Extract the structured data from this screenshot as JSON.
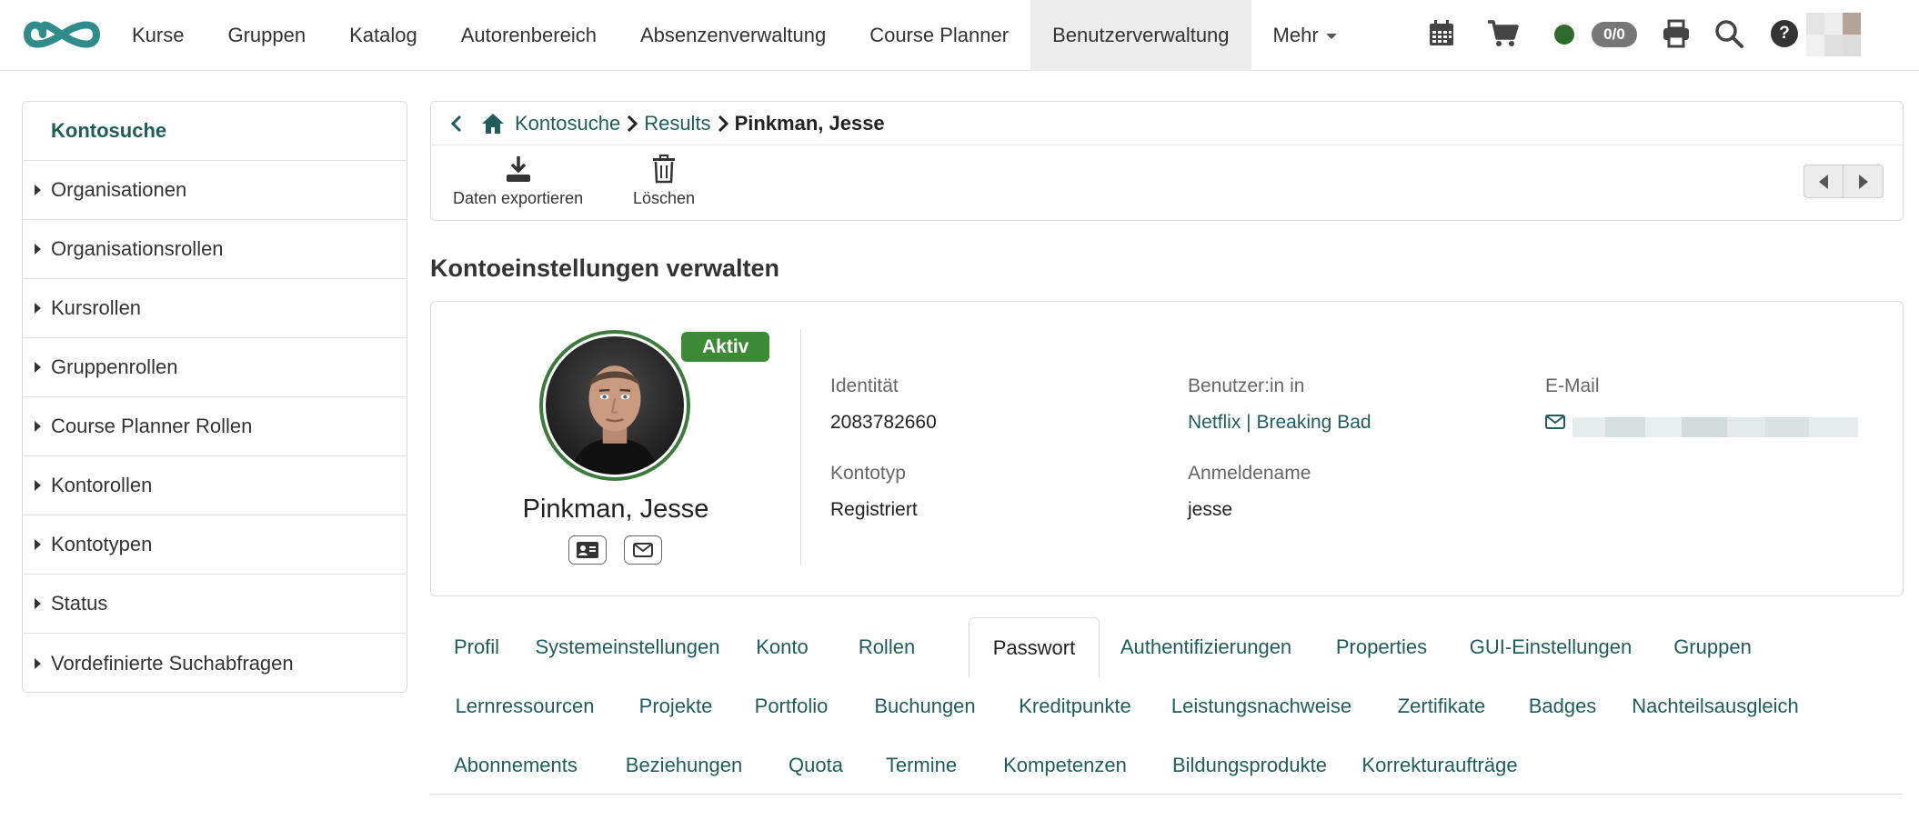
{
  "nav": {
    "items": [
      {
        "label": "Kurse"
      },
      {
        "label": "Gruppen"
      },
      {
        "label": "Katalog"
      },
      {
        "label": "Autorenbereich"
      },
      {
        "label": "Absenzenverwaltung"
      },
      {
        "label": "Course Planner"
      },
      {
        "label": "Benutzerverwaltung"
      },
      {
        "label": "Mehr"
      }
    ],
    "active": "Benutzerverwaltung",
    "badge_count": "0/0",
    "help": "?"
  },
  "colors": {
    "accent": "#1f5d5c",
    "logo": "#2f8c8a",
    "status_online": "#2d6a2d",
    "active_pill": "#3d8b37"
  },
  "sidebar": {
    "title": "Kontosuche",
    "items": [
      {
        "label": "Organisationen"
      },
      {
        "label": "Organisationsrollen"
      },
      {
        "label": "Kursrollen"
      },
      {
        "label": "Gruppenrollen"
      },
      {
        "label": "Course Planner Rollen"
      },
      {
        "label": "Kontorollen"
      },
      {
        "label": "Kontotypen"
      },
      {
        "label": "Status"
      },
      {
        "label": "Vordefinierte Suchabfragen"
      }
    ]
  },
  "breadcrumb": {
    "home": "Kontosuche",
    "results": "Results",
    "current": "Pinkman, Jesse"
  },
  "toolbar": {
    "export_label": "Daten exportieren",
    "delete_label": "Löschen"
  },
  "section": {
    "title": "Kontoeinstellungen verwalten"
  },
  "profile": {
    "status": "Aktiv",
    "name": "Pinkman, Jesse",
    "fields": {
      "identity_label": "Identität",
      "identity_value": "2083782660",
      "account_type_label": "Kontotyp",
      "account_type_value": "Registriert",
      "user_in_label": "Benutzer:in in",
      "user_in_value": "Netflix | Breaking Bad",
      "login_label": "Anmeldename",
      "login_value": "jesse",
      "email_label": "E-Mail"
    }
  },
  "tabs": {
    "active": "Passwort",
    "rows": [
      [
        "Profil",
        "Systemeinstellungen",
        "Konto",
        "Rollen",
        "Passwort",
        "Authentifizierungen",
        "Properties",
        "GUI-Einstellungen",
        "Gruppen"
      ],
      [
        "Lernressourcen",
        "Projekte",
        "Portfolio",
        "Buchungen",
        "Kreditpunkte",
        "Leistungsnachweise",
        "Zertifikate",
        "Badges",
        "Nachteilsausgleich"
      ],
      [
        "Abonnements",
        "Beziehungen",
        "Quota",
        "Termine",
        "Kompetenzen",
        "Bildungsprodukte",
        "Korrekturaufträge"
      ]
    ]
  }
}
